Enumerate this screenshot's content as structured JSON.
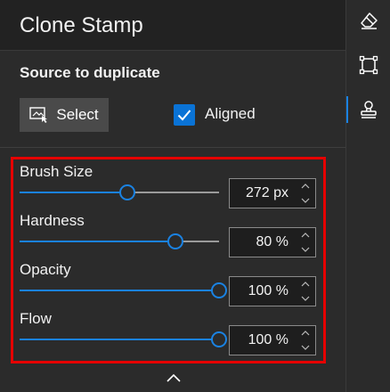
{
  "panel": {
    "title": "Clone Stamp",
    "section_title": "Source to duplicate",
    "select_label": "Select",
    "aligned_label": "Aligned",
    "aligned_checked": true
  },
  "sliders": [
    {
      "label": "Brush Size",
      "value": "272 px",
      "fraction": 0.54
    },
    {
      "label": "Hardness",
      "value": "80 %",
      "fraction": 0.78
    },
    {
      "label": "Opacity",
      "value": "100 %",
      "fraction": 1.0
    },
    {
      "label": "Flow",
      "value": "100 %",
      "fraction": 1.0
    }
  ],
  "tools": [
    {
      "name": "eraser-icon"
    },
    {
      "name": "selection-icon"
    },
    {
      "name": "clone-stamp-icon",
      "active": true
    }
  ],
  "colors": {
    "accent": "#1a82e2",
    "highlight": "#e60000",
    "checkbox": "#0a73d6"
  }
}
